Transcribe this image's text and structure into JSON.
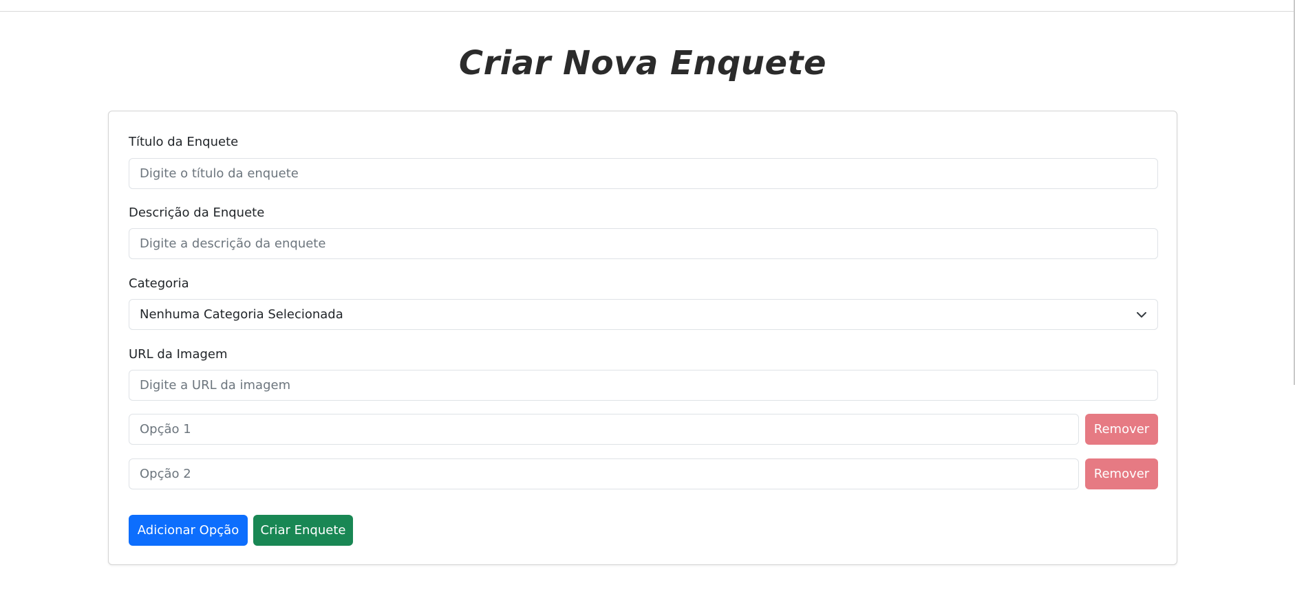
{
  "page": {
    "title": "Criar Nova Enquete"
  },
  "form": {
    "title_label": "Título da Enquete",
    "title_placeholder": "Digite o título da enquete",
    "description_label": "Descrição da Enquete",
    "description_placeholder": "Digite a descrição da enquete",
    "category_label": "Categoria",
    "category_selected": "Nenhuma Categoria Selecionada",
    "image_label": "URL da Imagem",
    "image_placeholder": "Digite a URL da imagem",
    "options": [
      {
        "placeholder": "Opção 1",
        "remove_label": "Remover"
      },
      {
        "placeholder": "Opção 2",
        "remove_label": "Remover"
      }
    ],
    "add_option_label": "Adicionar Opção",
    "create_label": "Criar Enquete"
  },
  "colors": {
    "primary": "#0d6efd",
    "success": "#198754",
    "danger_light": "#e67a83",
    "title_text": "#2b2b2b",
    "placeholder": "#6c757d"
  },
  "icons": {
    "select_arrow": "chevron-down-icon"
  }
}
